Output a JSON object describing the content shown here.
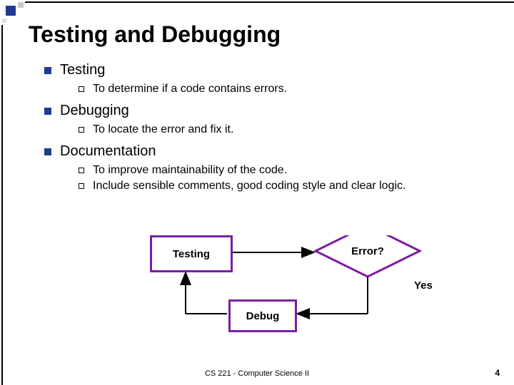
{
  "title": "Testing and Debugging",
  "bullets": {
    "b1": {
      "label": "Testing",
      "sub1": "To determine if a code contains errors."
    },
    "b2": {
      "label": "Debugging",
      "sub1": "To locate the error and fix it."
    },
    "b3": {
      "label": "Documentation",
      "sub1": "To improve maintainability of the code.",
      "sub2": "Include sensible comments, good coding style and clear logic."
    }
  },
  "diagram": {
    "testing": "Testing",
    "debug": "Debug",
    "error": "Error?",
    "yes": "Yes"
  },
  "footer": "CS 221 - Computer Science II",
  "page": "4"
}
